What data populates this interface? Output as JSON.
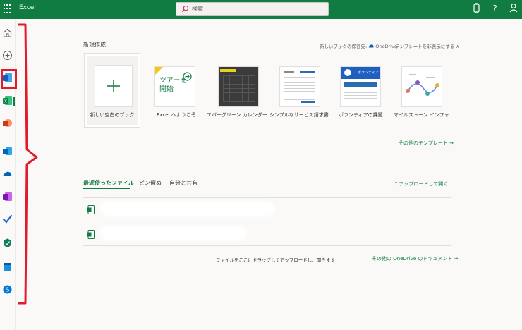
{
  "header": {
    "app_name": "Excel",
    "search_placeholder": "検索"
  },
  "rail": {
    "items": [
      "home-icon",
      "create-icon",
      "word-icon",
      "excel-icon",
      "powerpoint-icon",
      "outlook-icon",
      "onedrive-icon",
      "onenote-icon",
      "todo-icon",
      "defender-icon",
      "calendar-icon",
      "skype-icon"
    ]
  },
  "new_section": {
    "title": "新規作成",
    "save_location_prefix": "新しいブックの保存先:",
    "save_location": "OneDrive",
    "hide_templates": "テンプレートを非表示にする ∧",
    "more_templates": "その他のテンプレート →"
  },
  "templates": [
    {
      "label": "新しい空白のブック"
    },
    {
      "label": "Excel へようこそ",
      "thumb_text_1": "ツアーを",
      "thumb_text_2": "開始"
    },
    {
      "label": "エバーグリーン カレンダー"
    },
    {
      "label": "シンプルなサービス請求書"
    },
    {
      "label": "ボランティアの課題",
      "thumb_text": "ボランティア"
    },
    {
      "label": "マイルストーン インフォ..."
    }
  ],
  "files_section": {
    "tabs": [
      "最近使ったファイル",
      "ピン留め",
      "自分と共有"
    ],
    "upload_link": "アップロードして開く...",
    "drop_hint": "ファイルをここにドラッグしてアップロードし、開きます",
    "more_docs": "その他の OneDrive のドキュメント →"
  },
  "colors": {
    "excel_green": "#107c41",
    "annotation_red": "#e21b2b"
  }
}
